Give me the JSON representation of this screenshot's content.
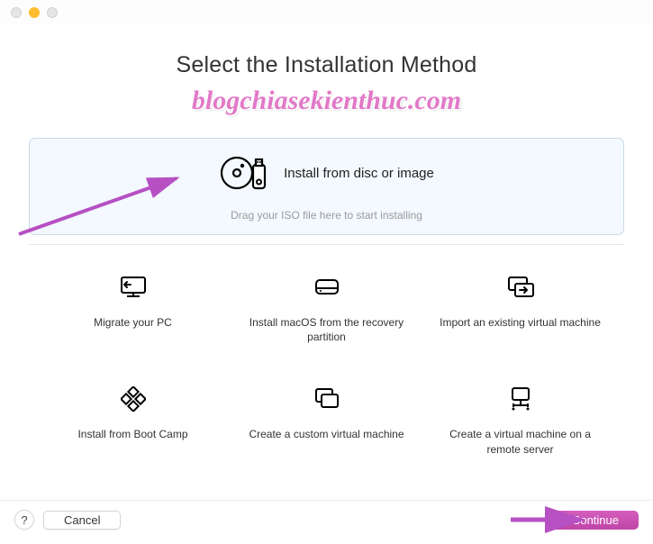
{
  "titlebar": {},
  "header": {
    "title": "Select the Installation Method",
    "watermark": "blogchiasekienthuc.com"
  },
  "dropzone": {
    "label": "Install from disc or image",
    "hint": "Drag your ISO file here to start installing"
  },
  "options": [
    {
      "label": "Migrate your PC"
    },
    {
      "label": "Install macOS from the recovery partition"
    },
    {
      "label": "Import an existing virtual machine"
    },
    {
      "label": "Install from Boot Camp"
    },
    {
      "label": "Create a custom virtual machine"
    },
    {
      "label": "Create a virtual machine on a remote server"
    }
  ],
  "footer": {
    "help": "?",
    "cancel": "Cancel",
    "continue": "Continue"
  },
  "colors": {
    "accent_pink": "#c044a8",
    "arrow_purple": "#b650c3"
  }
}
